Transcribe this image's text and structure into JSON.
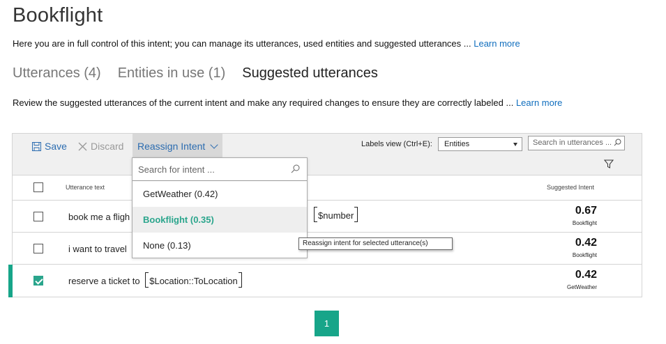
{
  "page": {
    "title": "Bookflight",
    "intro_text": "Here you are in full control of this intent; you can manage its utterances, used entities and suggested utterances ...",
    "learn_more": "Learn more"
  },
  "tabs": [
    {
      "label": "Utterances (4)",
      "active": false
    },
    {
      "label": "Entities in use (1)",
      "active": false
    },
    {
      "label": "Suggested utterances",
      "active": true
    }
  ],
  "review": {
    "text": "Review the suggested utterances of the current intent and make any required changes to ensure they are correctly labeled ...",
    "learn_more": "Learn more"
  },
  "toolbar": {
    "save_label": "Save",
    "discard_label": "Discard",
    "reassign_label": "Reassign Intent",
    "labels_view_label": "Labels view (Ctrl+E):",
    "labels_view_value": "Entities",
    "search_placeholder": "Search in utterances ..."
  },
  "table": {
    "col_utterance": "Utterance text",
    "col_intent": "Suggested Intent",
    "rows": [
      {
        "text": "book me a fligh",
        "entity_right": "$number",
        "score": "0.67",
        "intent": "Bookflight",
        "checked": false
      },
      {
        "text": "i want to travel",
        "score": "0.42",
        "intent": "Bookflight",
        "checked": false
      },
      {
        "text": "reserve a ticket to",
        "entity": "$Location::ToLocation",
        "score": "0.42",
        "intent": "GetWeather",
        "checked": true
      }
    ]
  },
  "dropdown": {
    "search_placeholder": "Search for intent ...",
    "items": [
      {
        "label": "GetWeather (0.42)",
        "highlighted": false
      },
      {
        "label": "Bookflight (0.35)",
        "highlighted": true
      },
      {
        "label": "None (0.13)",
        "highlighted": false
      }
    ]
  },
  "tooltip": "Reassign intent for selected utterance(s)",
  "pager": {
    "current": "1"
  },
  "colors": {
    "accent": "#17a589",
    "link": "#106ebe"
  }
}
